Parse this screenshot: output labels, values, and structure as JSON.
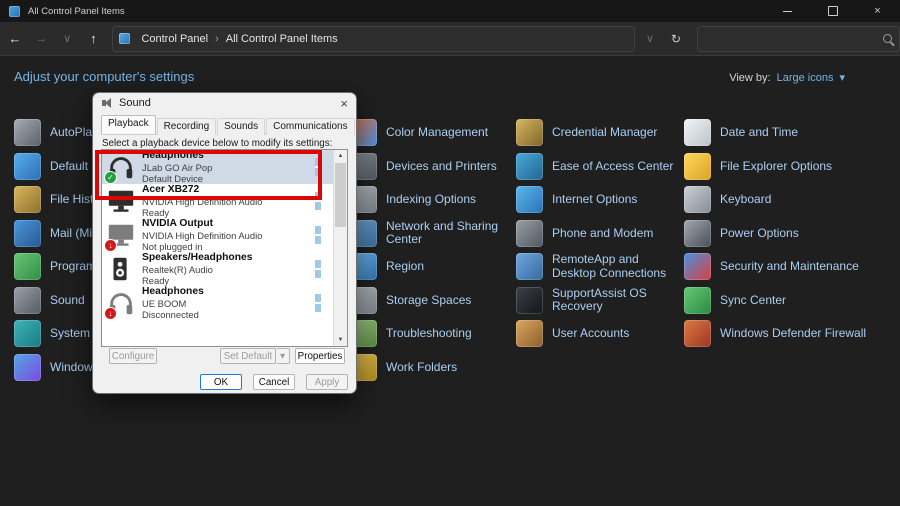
{
  "glyphs": {
    "back": "←",
    "forward": "→",
    "up": "↑",
    "chevron_down": "∨",
    "refresh": "↻",
    "breadcrumb_sep": "›",
    "close": "×",
    "check": "✓",
    "down_badge": "↓",
    "dropdown": "▾",
    "scroll_up": "▲",
    "scroll_down": "▼"
  },
  "titlebar": {
    "title": "All Control Panel Items"
  },
  "navbar": {
    "breadcrumb": [
      "Control Panel",
      "All Control Panel Items"
    ]
  },
  "header": {
    "title": "Adjust your computer's settings",
    "view_by_label": "View by:",
    "view_by_value": "Large icons"
  },
  "panel": {
    "columns": [
      {
        "items": [
          {
            "label": "AutoPlay",
            "icon": "autoplay"
          },
          {
            "label": "Default Pro",
            "icon": "default-programs"
          },
          {
            "label": "File History",
            "icon": "file-history"
          },
          {
            "label": "Mail (Micro",
            "icon": "mail"
          },
          {
            "label": "Programs a",
            "icon": "programs"
          },
          {
            "label": "Sound",
            "icon": "sound"
          },
          {
            "label": "System",
            "icon": "system"
          },
          {
            "label": "Windows M",
            "icon": "windows-mobility"
          }
        ]
      },
      {
        "items": [
          {
            "label": "Color Management",
            "icon": "color-management"
          },
          {
            "label": "Devices and Printers",
            "icon": "devices-printers"
          },
          {
            "label": "Indexing Options",
            "icon": "indexing"
          },
          {
            "label": "Network and Sharing Center",
            "icon": "network"
          },
          {
            "label": "Region",
            "icon": "region"
          },
          {
            "label": "Storage Spaces",
            "icon": "storage-spaces"
          },
          {
            "label": "Troubleshooting",
            "icon": "troubleshooting"
          },
          {
            "label": "Work Folders",
            "icon": "work-folders"
          }
        ]
      },
      {
        "items": [
          {
            "label": "Credential Manager",
            "icon": "credential-manager"
          },
          {
            "label": "Ease of Access Center",
            "icon": "ease-of-access"
          },
          {
            "label": "Internet Options",
            "icon": "internet-options"
          },
          {
            "label": "Phone and Modem",
            "icon": "phone-modem"
          },
          {
            "label": "RemoteApp and Desktop Connections",
            "icon": "remoteapp"
          },
          {
            "label": "SupportAssist OS Recovery",
            "icon": "supportassist"
          },
          {
            "label": "User Accounts",
            "icon": "user-accounts"
          }
        ]
      },
      {
        "items": [
          {
            "label": "Date and Time",
            "icon": "date-time"
          },
          {
            "label": "File Explorer Options",
            "icon": "file-explorer-options"
          },
          {
            "label": "Keyboard",
            "icon": "keyboard"
          },
          {
            "label": "Power Options",
            "icon": "power-options"
          },
          {
            "label": "Security and Maintenance",
            "icon": "security-maintenance"
          },
          {
            "label": "Sync Center",
            "icon": "sync-center"
          },
          {
            "label": "Windows Defender Firewall",
            "icon": "windows-defender-firewall"
          }
        ]
      }
    ]
  },
  "dialog": {
    "title": "Sound",
    "tabs": [
      {
        "label": "Playback",
        "active": true
      },
      {
        "label": "Recording",
        "active": false
      },
      {
        "label": "Sounds",
        "active": false
      },
      {
        "label": "Communications",
        "active": false
      }
    ],
    "instruction": "Select a playback device below to modify its settings:",
    "devices": [
      {
        "name": "Headphones",
        "desc": "JLab GO Air Pop",
        "status": "Default Device",
        "icon": "headphones",
        "badge": "check",
        "selected": true
      },
      {
        "name": "Acer XB272",
        "desc": "NVIDIA High Definition Audio",
        "status": "Ready",
        "icon": "monitor",
        "badge": null,
        "selected": false
      },
      {
        "name": "NVIDIA Output",
        "desc": "NVIDIA High Definition Audio",
        "status": "Not plugged in",
        "icon": "monitor",
        "badge": "down",
        "selected": false
      },
      {
        "name": "Speakers/Headphones",
        "desc": "Realtek(R) Audio",
        "status": "Ready",
        "icon": "speaker",
        "badge": null,
        "selected": false
      },
      {
        "name": "Headphones",
        "desc": "UE BOOM",
        "status": "Disconnected",
        "icon": "headphones",
        "badge": "down",
        "selected": false
      }
    ],
    "buttons": {
      "configure": "Configure",
      "set_default": "Set Default",
      "properties": "Properties",
      "ok": "OK",
      "cancel": "Cancel",
      "apply": "Apply"
    }
  },
  "annotation": {
    "highlight_color": "#dd0606"
  }
}
